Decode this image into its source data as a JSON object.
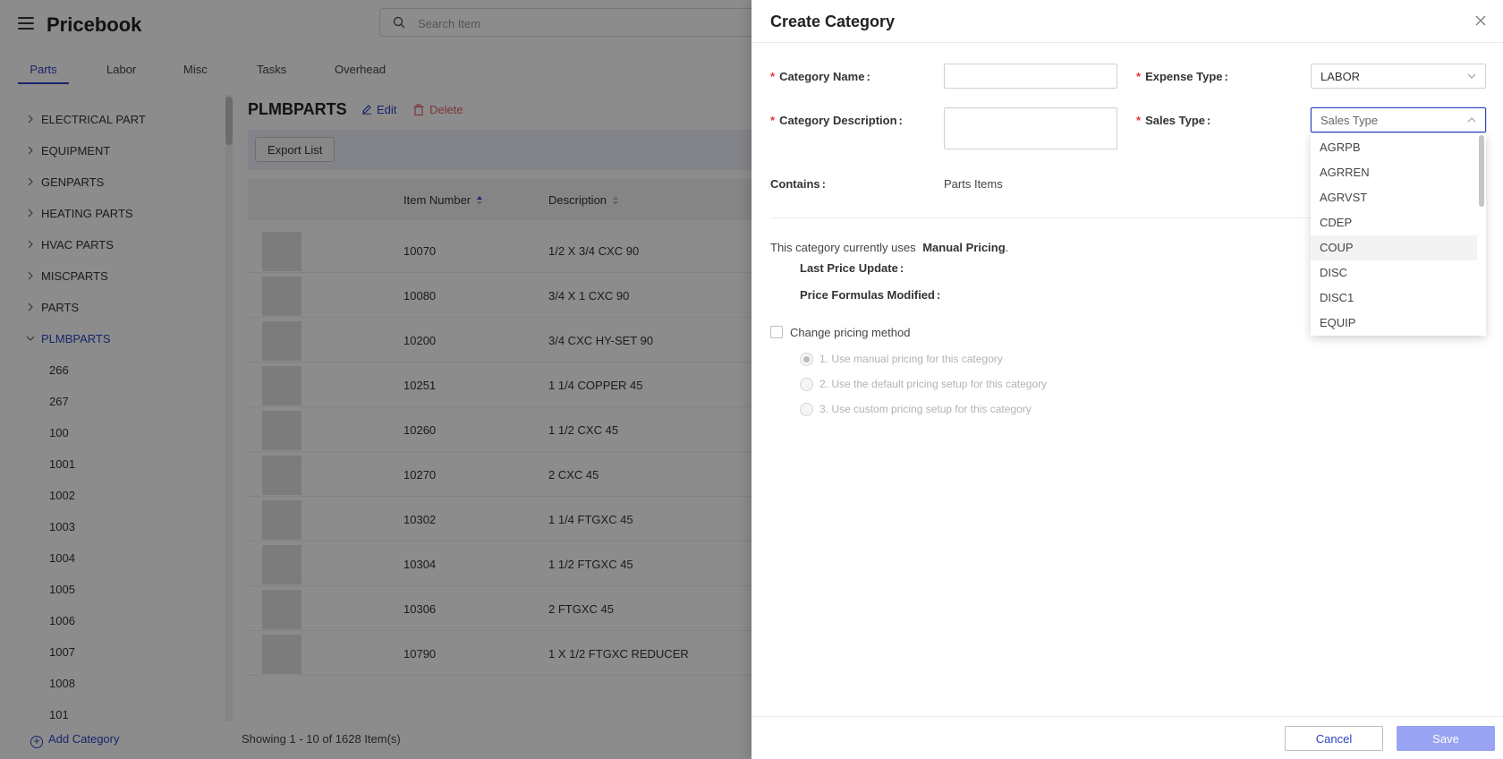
{
  "app": {
    "title": "Pricebook",
    "search_placeholder": "Search Item"
  },
  "tabs": [
    {
      "label": "Parts",
      "active": true
    },
    {
      "label": "Labor"
    },
    {
      "label": "Misc"
    },
    {
      "label": "Tasks"
    },
    {
      "label": "Overhead"
    }
  ],
  "sidebar": {
    "categories": [
      "ELECTRICAL PART",
      "EQUIPMENT",
      "GENPARTS",
      "HEATING PARTS",
      "HVAC PARTS",
      "MISCPARTS",
      "PARTS",
      "PLMBPARTS"
    ],
    "expanded": "PLMBPARTS",
    "subcategories": [
      "266",
      "267",
      "100",
      "1001",
      "1002",
      "1003",
      "1004",
      "1005",
      "1006",
      "1007",
      "1008",
      "101"
    ],
    "add_category_label": "Add Category"
  },
  "main": {
    "category_title": "PLMBPARTS",
    "edit_label": "Edit",
    "delete_label": "Delete",
    "export_label": "Export List",
    "columns": [
      "Item Number",
      "Description"
    ],
    "rows": [
      {
        "item_number": "10070",
        "description": "1/2 X 3/4 CXC 90"
      },
      {
        "item_number": "10080",
        "description": "3/4 X 1 CXC 90"
      },
      {
        "item_number": "10200",
        "description": "3/4 CXC HY-SET 90"
      },
      {
        "item_number": "10251",
        "description": "1 1/4 COPPER 45"
      },
      {
        "item_number": "10260",
        "description": "1 1/2 CXC 45"
      },
      {
        "item_number": "10270",
        "description": "2 CXC 45"
      },
      {
        "item_number": "10302",
        "description": "1 1/4 FTGXC 45"
      },
      {
        "item_number": "10304",
        "description": "1 1/2 FTGXC 45"
      },
      {
        "item_number": "10306",
        "description": "2 FTGXC 45"
      },
      {
        "item_number": "10790",
        "description": "1 X 1/2 FTGXC REDUCER"
      }
    ],
    "showing_text": "Showing 1 - 10 of 1628 Item(s)"
  },
  "drawer": {
    "title": "Create Category",
    "category_name_label": "Category Name",
    "category_name_value": "",
    "category_description_label": "Category Description",
    "category_description_value": "",
    "expense_type_label": "Expense Type",
    "expense_type_value": "LABOR",
    "sales_type_label": "Sales Type",
    "sales_type_placeholder": "Sales Type",
    "contains_label": "Contains",
    "contains_value": "Parts Items",
    "pricing_text": "This category currently uses",
    "pricing_method": "Manual Pricing",
    "last_price_update_label": "Last Price Update",
    "price_formulas_modified_label": "Price Formulas Modified",
    "change_pricing_label": "Change pricing method",
    "pricing_options": [
      "1.  Use manual pricing for this category",
      "2.  Use the default pricing setup for this category",
      "3.  Use custom pricing setup for this category"
    ],
    "sales_type_options": [
      "AGRPB",
      "AGRREN",
      "AGRVST",
      "CDEP",
      "COUP",
      "DISC",
      "DISC1",
      "EQUIP"
    ],
    "hovered_option": "COUP",
    "cancel_label": "Cancel",
    "save_label": "Save"
  },
  "colors": {
    "accent": "#2b44c6",
    "required": "#e53935",
    "save_button": "#98a3f3",
    "delete": "#e06565"
  }
}
